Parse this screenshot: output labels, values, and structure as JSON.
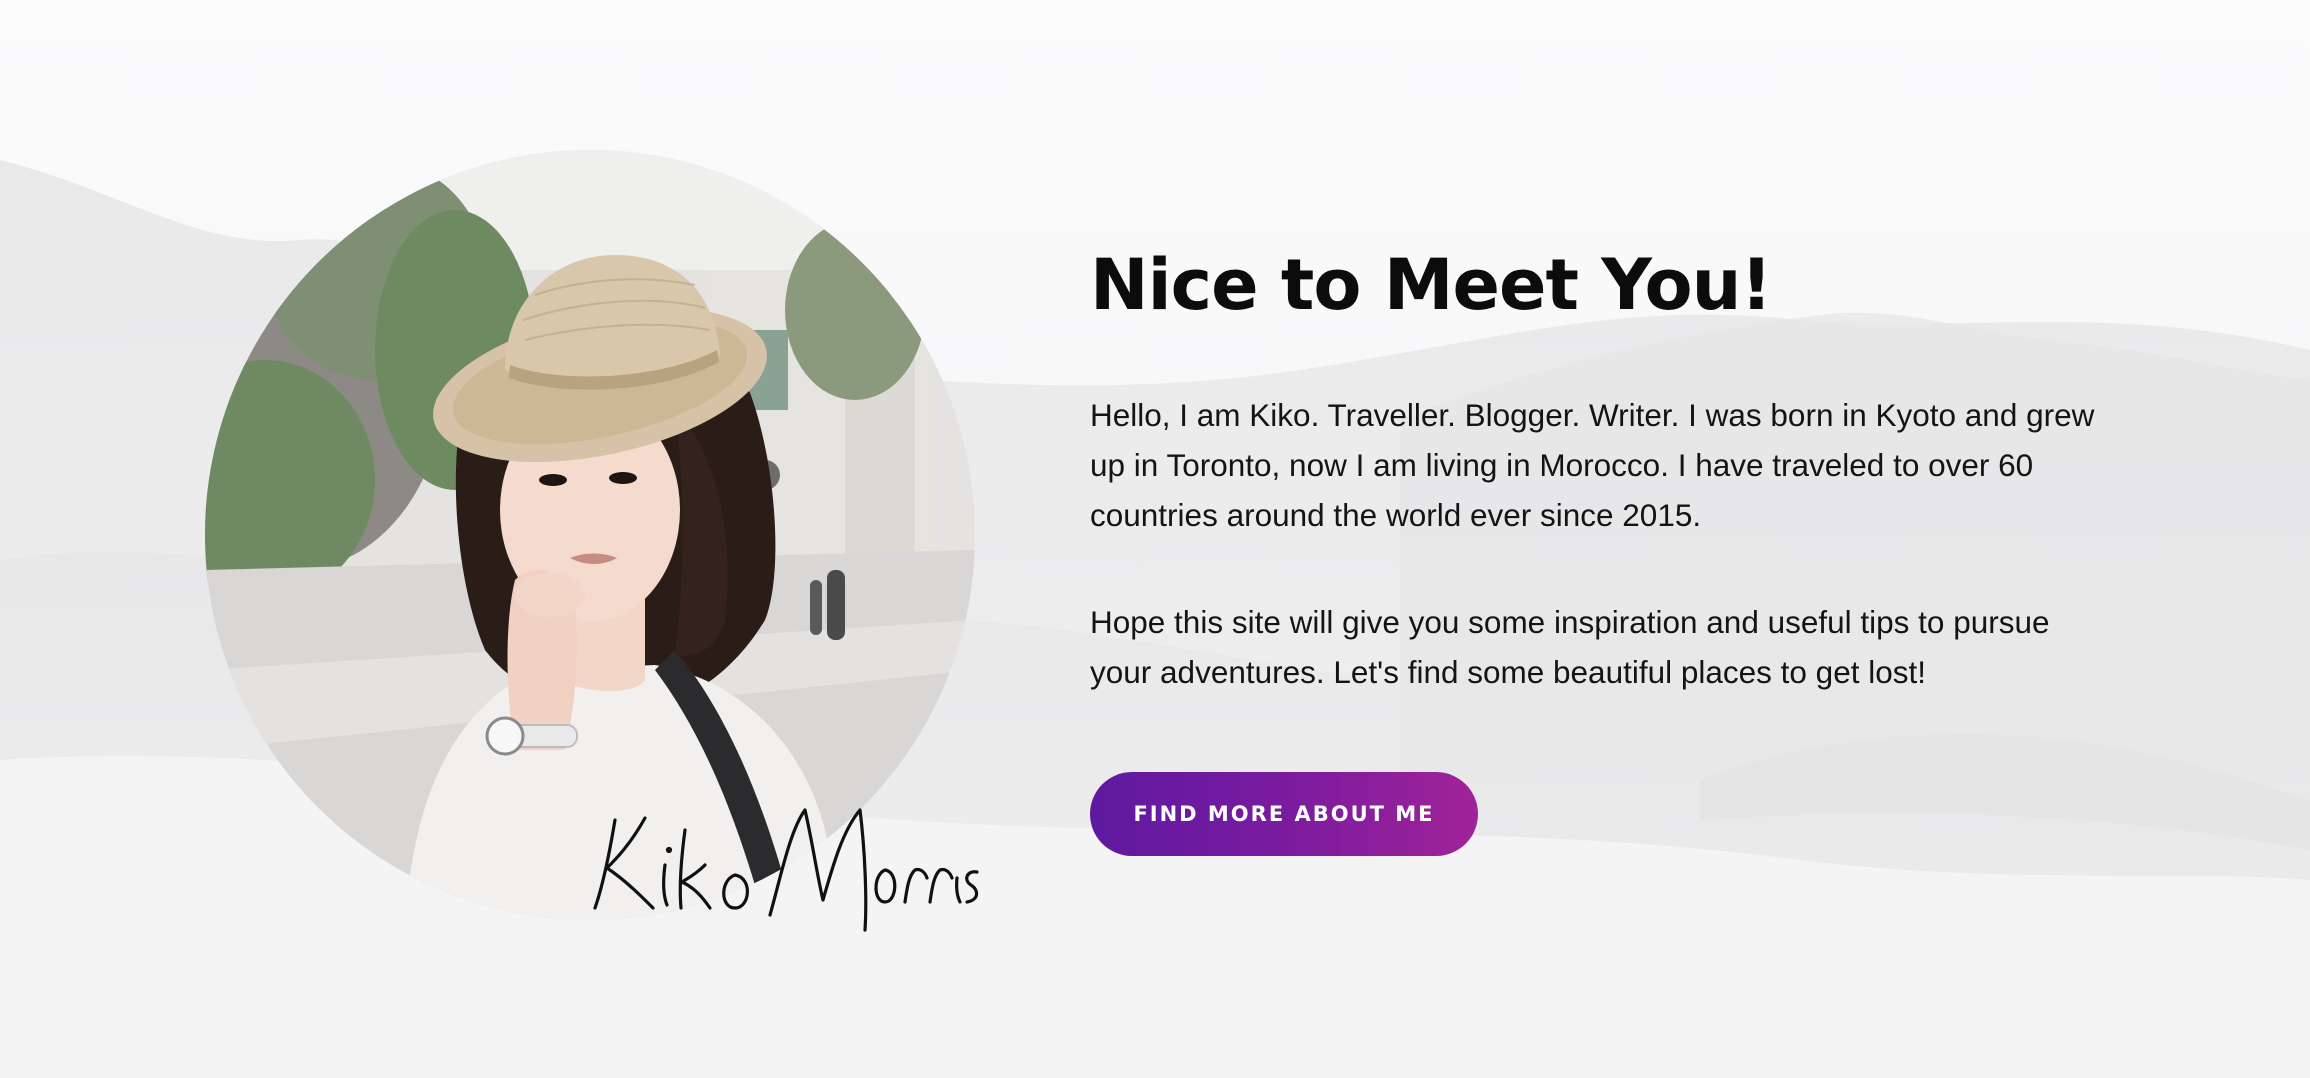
{
  "about": {
    "title": "Nice to Meet You!",
    "paragraph_1": "Hello, I am Kiko. Traveller. Blogger. Writer. I was born in Kyoto and grew up in Toronto, now I am living in Morocco. I have traveled to over 60 countries around the world ever since 2015.",
    "paragraph_2": "Hope this site will give you some inspiration and useful tips to pursue your adventures. Let's find some beautiful places to get lost!",
    "cta_label": "FIND MORE ABOUT ME",
    "signature": "Kiko Morris",
    "portrait_alt": "Portrait of Kiko in a straw hat"
  },
  "colors": {
    "cta_gradient_start": "#5e1aa0",
    "cta_gradient_end": "#a02398",
    "heading": "#0c0c0c",
    "body_text": "#141414"
  }
}
